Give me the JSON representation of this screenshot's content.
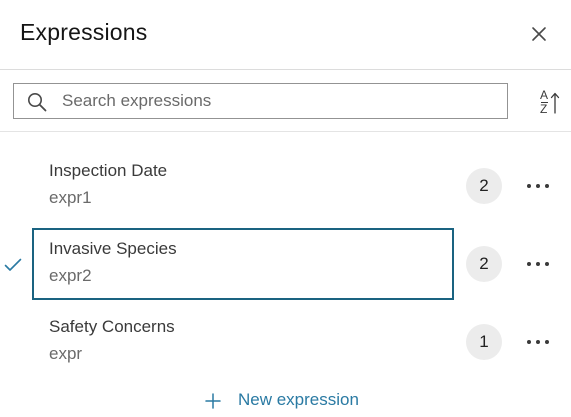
{
  "panel": {
    "title": "Expressions",
    "close_icon": "close-icon"
  },
  "search": {
    "placeholder": "Search expressions",
    "value": "",
    "search_icon": "search-icon",
    "sort_icon": "sort-ascending-icon",
    "sort_glyph_top": "A",
    "sort_glyph_bottom": "Z"
  },
  "expressions": [
    {
      "name": "Inspection Date",
      "id": "expr1",
      "count": "2",
      "selected": false
    },
    {
      "name": "Invasive Species",
      "id": "expr2",
      "count": "2",
      "selected": true
    },
    {
      "name": "Safety Concerns",
      "id": "expr",
      "count": "1",
      "selected": false
    }
  ],
  "footer": {
    "new_expression_label": "New expression",
    "plus_icon": "plus-icon"
  },
  "colors": {
    "accent": "#2a7aa3",
    "selected_border": "#1a6381",
    "badge_bg": "#ececec"
  }
}
